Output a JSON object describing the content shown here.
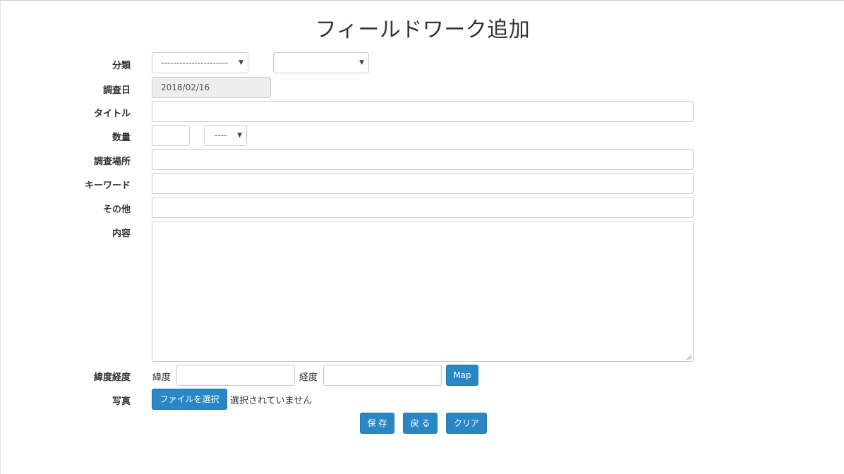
{
  "page": {
    "title": "フィールドワーク追加"
  },
  "form": {
    "category_label": "分類",
    "category_select1_value": "----------------------",
    "category_select2_value": "",
    "survey_date_label": "調査日",
    "survey_date_value": "2018/02/16",
    "title_label": "タイトル",
    "quantity_label": "数量",
    "quantity_unit_value": "----",
    "location_label": "調査場所",
    "keyword_label": "キーワード",
    "other_label": "その他",
    "content_label": "内容",
    "latlng_label": "緯度経度",
    "latitude_label": "緯度",
    "longitude_label": "経度",
    "map_button": "Map",
    "photo_label": "写真",
    "file_button": "ファイルを選択",
    "file_status": "選択されていません"
  },
  "actions": {
    "save": "保 存",
    "back": "戻 る",
    "clear": "クリア"
  }
}
